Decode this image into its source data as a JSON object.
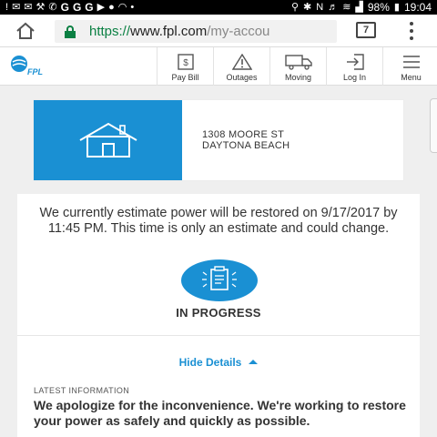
{
  "status_bar": {
    "battery": "98%",
    "time": "19:04"
  },
  "browser": {
    "url_scheme": "https://",
    "url_host": "www.fpl.com",
    "url_path": "/my-accou",
    "tab_count": "7"
  },
  "site": {
    "logo_text": "FPL",
    "nav": [
      {
        "label": "Pay Bill",
        "icon": "pay-bill-icon"
      },
      {
        "label": "Outages",
        "icon": "outages-icon"
      },
      {
        "label": "Moving",
        "icon": "truck-icon"
      },
      {
        "label": "Log In",
        "icon": "login-icon"
      },
      {
        "label": "Menu",
        "icon": "hamburger-icon"
      }
    ]
  },
  "address": {
    "line1": "1308 MOORE ST",
    "line2": "DAYTONA BEACH"
  },
  "status": {
    "estimate_text": "We currently estimate power will be restored on 9/17/2017 by 11:45 PM. This time is only an estimate and could change.",
    "progress_label": "IN PROGRESS",
    "hide_details_label": "Hide Details",
    "latest_label": "LATEST INFORMATION",
    "latest_message": "We apologize for the inconvenience. We're working to restore your power as safely and quickly as possible."
  },
  "colors": {
    "accent": "#1a90d3",
    "url_scheme": "#0b8043"
  }
}
